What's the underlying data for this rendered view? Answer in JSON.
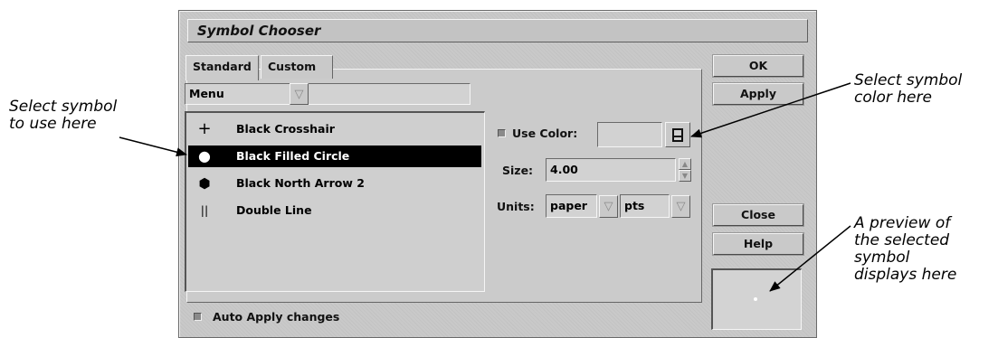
{
  "dialog": {
    "title": "Symbol Chooser",
    "tabs": [
      {
        "label": "Standard",
        "active": true
      },
      {
        "label": "Custom",
        "active": false
      }
    ],
    "menu_combo": {
      "value": "Menu"
    },
    "symbols": [
      {
        "glyph": "+",
        "label": "Black Crosshair",
        "selected": false
      },
      {
        "glyph": "●",
        "label": "Black Filled Circle",
        "selected": true
      },
      {
        "glyph": "⬢",
        "label": "Black North Arrow 2",
        "selected": false
      },
      {
        "glyph": "||",
        "label": "Double Line",
        "selected": false
      }
    ],
    "use_color": {
      "label": "Use Color:",
      "checked": false,
      "value": ""
    },
    "size": {
      "label": "Size:",
      "value": "4.00"
    },
    "units": {
      "label": "Units:",
      "first": "paper",
      "second": "pts"
    },
    "auto_apply": {
      "label": "Auto Apply changes",
      "checked": false
    },
    "buttons": {
      "ok": "OK",
      "apply": "Apply",
      "close": "Close",
      "help": "Help"
    }
  },
  "callouts": {
    "left": [
      "Select symbol",
      "to use here"
    ],
    "top_right": [
      "Select symbol",
      "color here"
    ],
    "bottom_right": [
      "A preview of",
      "the selected",
      "symbol",
      "displays here"
    ]
  },
  "colors": {
    "dialog_bg": "#c9c9c9",
    "selection_bg": "#000000",
    "selection_fg": "#ffffff"
  }
}
